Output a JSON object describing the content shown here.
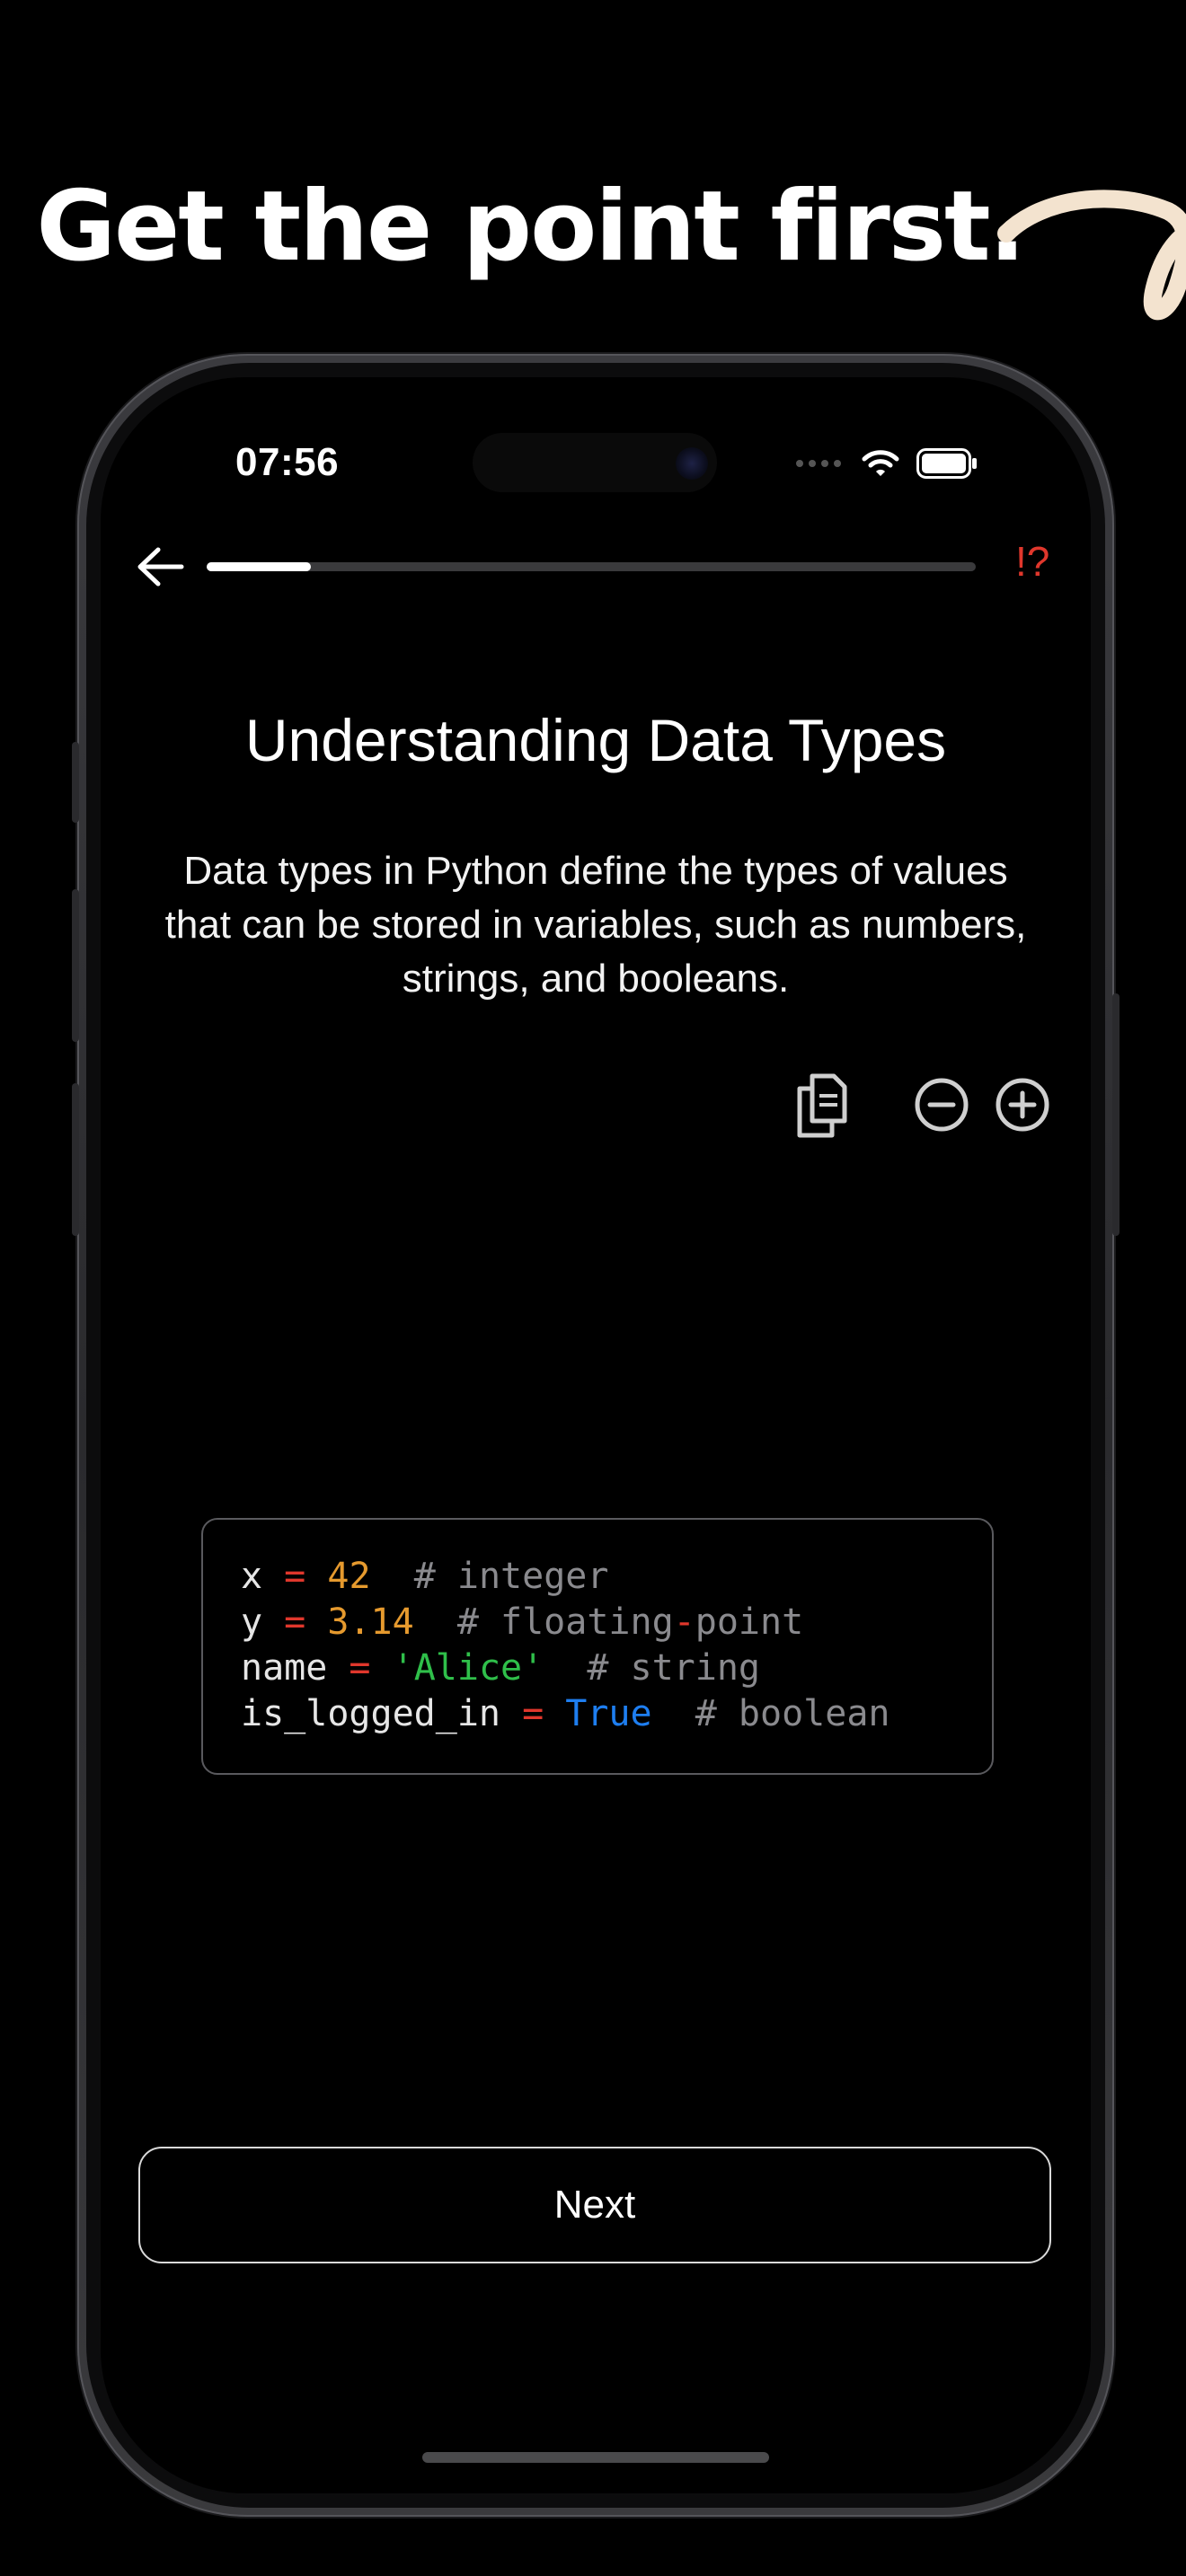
{
  "headline": "Get the point first.",
  "status_bar": {
    "time": "07:56"
  },
  "nav": {
    "progress_fraction": 0.136,
    "report_label": "!?"
  },
  "lesson": {
    "title": "Understanding Data Types",
    "description": "Data types in Python define the types of values that can be stored in variables, such as numbers, strings, and booleans."
  },
  "code": {
    "lines": [
      [
        {
          "t": "x ",
          "c": "plain"
        },
        {
          "t": "=",
          "c": "op"
        },
        {
          "t": " ",
          "c": "plain"
        },
        {
          "t": "42",
          "c": "num"
        },
        {
          "t": "  # integer",
          "c": "com"
        }
      ],
      [
        {
          "t": "y ",
          "c": "plain"
        },
        {
          "t": "=",
          "c": "op"
        },
        {
          "t": " ",
          "c": "plain"
        },
        {
          "t": "3.14",
          "c": "num"
        },
        {
          "t": "  # floating",
          "c": "com"
        },
        {
          "t": "-",
          "c": "op"
        },
        {
          "t": "point",
          "c": "com"
        }
      ],
      [
        {
          "t": "name ",
          "c": "plain"
        },
        {
          "t": "=",
          "c": "op"
        },
        {
          "t": " ",
          "c": "plain"
        },
        {
          "t": "'Alice'",
          "c": "str"
        },
        {
          "t": "  # string",
          "c": "com"
        }
      ],
      [
        {
          "t": "is_logged_in ",
          "c": "plain"
        },
        {
          "t": "=",
          "c": "op"
        },
        {
          "t": " ",
          "c": "plain"
        },
        {
          "t": "True",
          "c": "kw"
        },
        {
          "t": "  # boolean",
          "c": "com"
        }
      ]
    ]
  },
  "actions": {
    "next_label": "Next"
  },
  "colors": {
    "accent_red": "#e0372c",
    "number": "#e69a2e",
    "string": "#2fbf4a",
    "keyword": "#1e7ef0",
    "comment": "#8a8a8e"
  },
  "icons": [
    "back-arrow-icon",
    "copy-icon",
    "zoom-out-icon",
    "zoom-in-icon",
    "wifi-icon",
    "battery-icon",
    "cellular-icon"
  ]
}
